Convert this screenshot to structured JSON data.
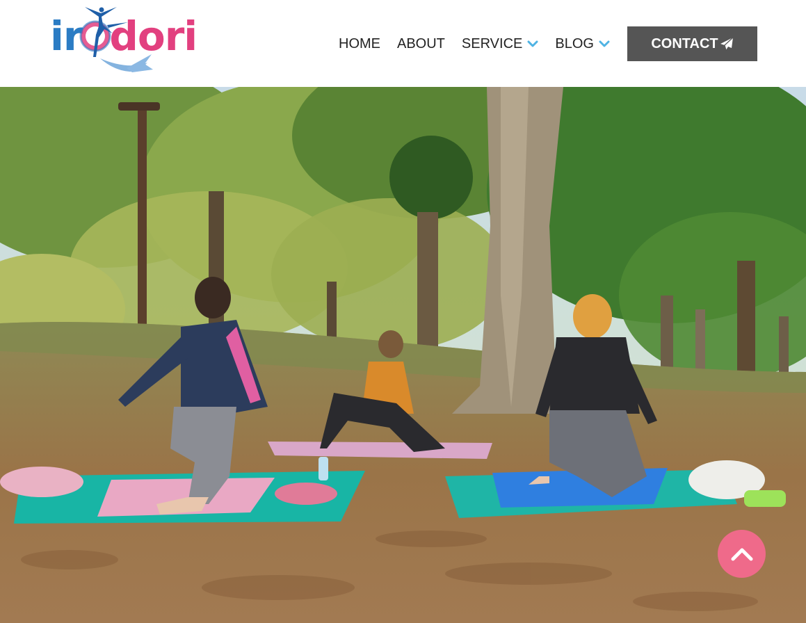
{
  "logo": {
    "text_blue": "ir",
    "text_o": "o",
    "text_pink": "dori"
  },
  "nav": {
    "items": [
      {
        "label": "HOME"
      },
      {
        "label": "ABOUT"
      },
      {
        "label": "SERVICE",
        "has_dropdown": true
      },
      {
        "label": "BLOG",
        "has_dropdown": true
      }
    ],
    "contact_label": "CONTACT",
    "contact_icon": "paper-plane-icon"
  },
  "colors": {
    "brand_pink": "#e2407f",
    "brand_blue": "#2b7cc4",
    "chevron_blue": "#4fb3e3",
    "contact_bg": "#555555",
    "scroll_top_bg": "#ef6a8a"
  },
  "hero": {
    "image": "photo of three women doing a lunge yoga pose on mats in a park under autumn trees"
  },
  "scroll_top": {
    "icon": "chevron-up-icon"
  }
}
